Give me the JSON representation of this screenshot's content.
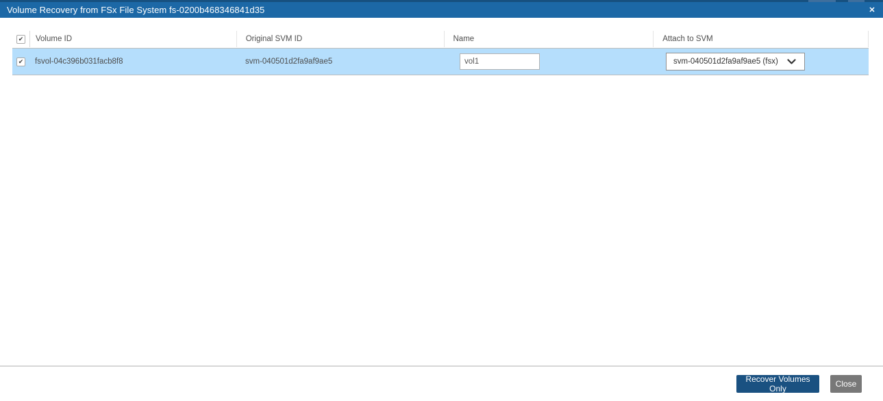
{
  "modal": {
    "title": "Volume Recovery from FSx File System fs-0200b468346841d35"
  },
  "icons": {
    "close": "✕",
    "check": "✔"
  },
  "table": {
    "columns": [
      "Volume ID",
      "Original SVM ID",
      "Name",
      "Attach to SVM"
    ],
    "header_checkbox_checked": true,
    "rows": [
      {
        "checked": true,
        "volume_id": "fsvol-04c396b031facb8f8",
        "original_svm_id": "svm-040501d2fa9af9ae5",
        "name_value": "vol1",
        "attach_to_svm_selected": "svm-040501d2fa9af9ae5 (fsx)"
      }
    ]
  },
  "footer": {
    "recover_button_label": "Recover Volumes Only",
    "close_button_label": "Close"
  },
  "colors": {
    "title_bar": "#1c68a6",
    "row_highlight": "#b5defc",
    "recover_button": "#1a5181",
    "close_button": "#787878"
  }
}
